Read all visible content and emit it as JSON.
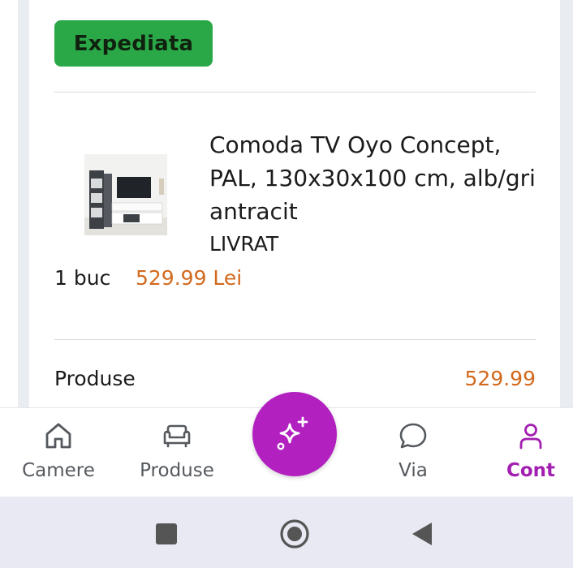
{
  "order": {
    "status_badge": "Expediata"
  },
  "product": {
    "title": "Comoda TV Oyo Concept, PAL, 130x30x100 cm, alb/gri antracit",
    "status": "LIVRAT",
    "quantity": "1 buc",
    "price": "529.99 Lei"
  },
  "summary": {
    "products_label": "Produse",
    "products_value": "529.99"
  },
  "bottom_nav": {
    "items": [
      {
        "label": "Camere",
        "icon": "home-icon"
      },
      {
        "label": "Produse",
        "icon": "sofa-icon"
      },
      {
        "label": "Via",
        "icon": "chat-bubble-icon"
      },
      {
        "label": "Cont",
        "icon": "user-icon"
      }
    ],
    "active": "Cont",
    "fab_icon": "sparkles-icon"
  },
  "system_nav": {
    "icons": [
      "recents-square-icon",
      "home-circle-icon",
      "back-triangle-icon"
    ]
  },
  "colors": {
    "badge_green": "#2aa847",
    "price_orange": "#d2691e",
    "accent_purple": "#b221c0",
    "active_nav_purple": "#a31fb1"
  }
}
